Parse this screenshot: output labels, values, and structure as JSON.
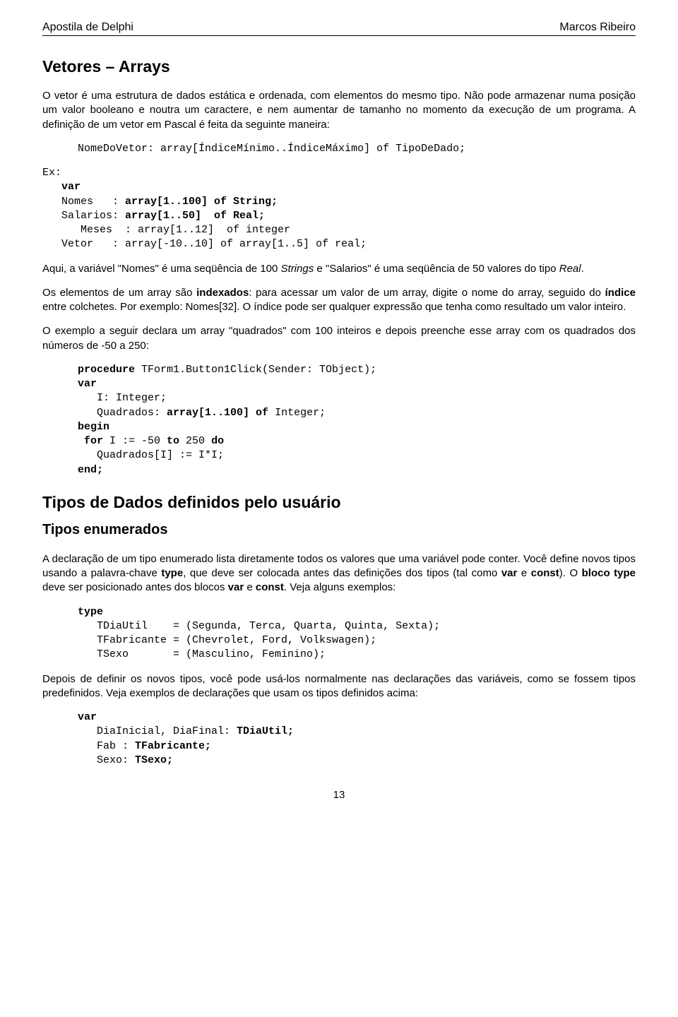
{
  "header": {
    "left": "Apostila de Delphi",
    "right": "Marcos Ribeiro"
  },
  "sec1": {
    "title": "Vetores – Arrays",
    "p1": "O vetor é uma estrutura de dados estática e ordenada, com elementos do mesmo tipo. Não pode armazenar numa posição um valor booleano e noutra um caractere, e nem aumentar de tamanho no momento da execução de um programa. A definição de um vetor em Pascal é feita da seguinte maneira:",
    "code1": "NomeDoVetor: array[ÍndiceMínimo..ÍndiceMáximo] of TipoDeDado;",
    "ex_label": "Ex:",
    "c2_var": "var",
    "c2_l1a": "   Nomes   : ",
    "c2_l1b": "array[1..100] of String;",
    "c2_l2a": "   Salarios: ",
    "c2_l2b": "array[1..50]  of Real;",
    "c2_l3": "      Meses  : array[1..12]  of integer",
    "c2_l4": "   Vetor   : array[-10..10] of array[1..5] of real;",
    "p2a": "Aqui, a variável \"Nomes\" é uma seqüência de 100 ",
    "p2b": "Strings",
    "p2c": " e \"Salarios\" é uma seqüência de 50 valores do tipo ",
    "p2d": "Real",
    "p2e": ".",
    "p3a": "Os elementos de um array são ",
    "p3b": "indexados",
    "p3c": ": para acessar um valor de um array, digite o nome do array, seguido do ",
    "p3d": "índice",
    "p3e": " entre colchetes. Por exemplo: Nomes[32]. O índice pode ser qualquer expressão que tenha como resultado um valor inteiro.",
    "p4": "O exemplo a seguir declara um array \"quadrados\" com 100 inteiros e depois preenche esse array com os quadrados dos números de -50 a 250:",
    "c3_l1a": "procedure ",
    "c3_l1b": "TForm1.Button1Click(Sender: TObject);",
    "c3_l2": "var",
    "c3_l3": "   I: Integer;",
    "c3_l4a": "   Quadrados: ",
    "c3_l4b": "array[1..100] of ",
    "c3_l4c": "Integer;",
    "c3_l5": "begin",
    "c3_l6a": " for ",
    "c3_l6b": "I := -50 ",
    "c3_l6c": "to ",
    "c3_l6d": "250 ",
    "c3_l6e": "do",
    "c3_l7": "   Quadrados[I] := I*I;",
    "c3_l8": "end;"
  },
  "sec2": {
    "title": "Tipos de Dados definidos pelo usuário",
    "sub": "Tipos enumerados",
    "p1a": "A declaração de um tipo enumerado lista diretamente todos os valores que uma variável pode conter. Você define novos tipos usando a palavra-chave ",
    "p1b": "type",
    "p1c": ", que deve ser colocada antes das definições dos tipos (tal como ",
    "p1d": "var",
    "p1e": " e ",
    "p1f": "const",
    "p1g": "). O ",
    "p1h": "bloco type",
    "p1i": " deve ser posicionado antes dos blocos ",
    "p1j": "var",
    "p1k": " e ",
    "p1l": "const",
    "p1m": ". Veja alguns exemplos:",
    "c1_l1": "type",
    "c1_l2": "   TDiaUtil    = (Segunda, Terca, Quarta, Quinta, Sexta);",
    "c1_l3": "   TFabricante = (Chevrolet, Ford, Volkswagen);",
    "c1_l4": "   TSexo       = (Masculino, Feminino);",
    "p2": "Depois de definir os novos tipos, você pode usá-los normalmente nas declarações das variáveis, como se fossem tipos predefinidos. Veja exemplos de declarações que usam os tipos definidos acima:",
    "c2_l1": "var",
    "c2_l2a": "   DiaInicial, DiaFinal: ",
    "c2_l2b": "TDiaUtil;",
    "c2_l3a": "   Fab : ",
    "c2_l3b": "TFabricante;",
    "c2_l4a": "   Sexo: ",
    "c2_l4b": "TSexo;"
  },
  "page_number": "13"
}
